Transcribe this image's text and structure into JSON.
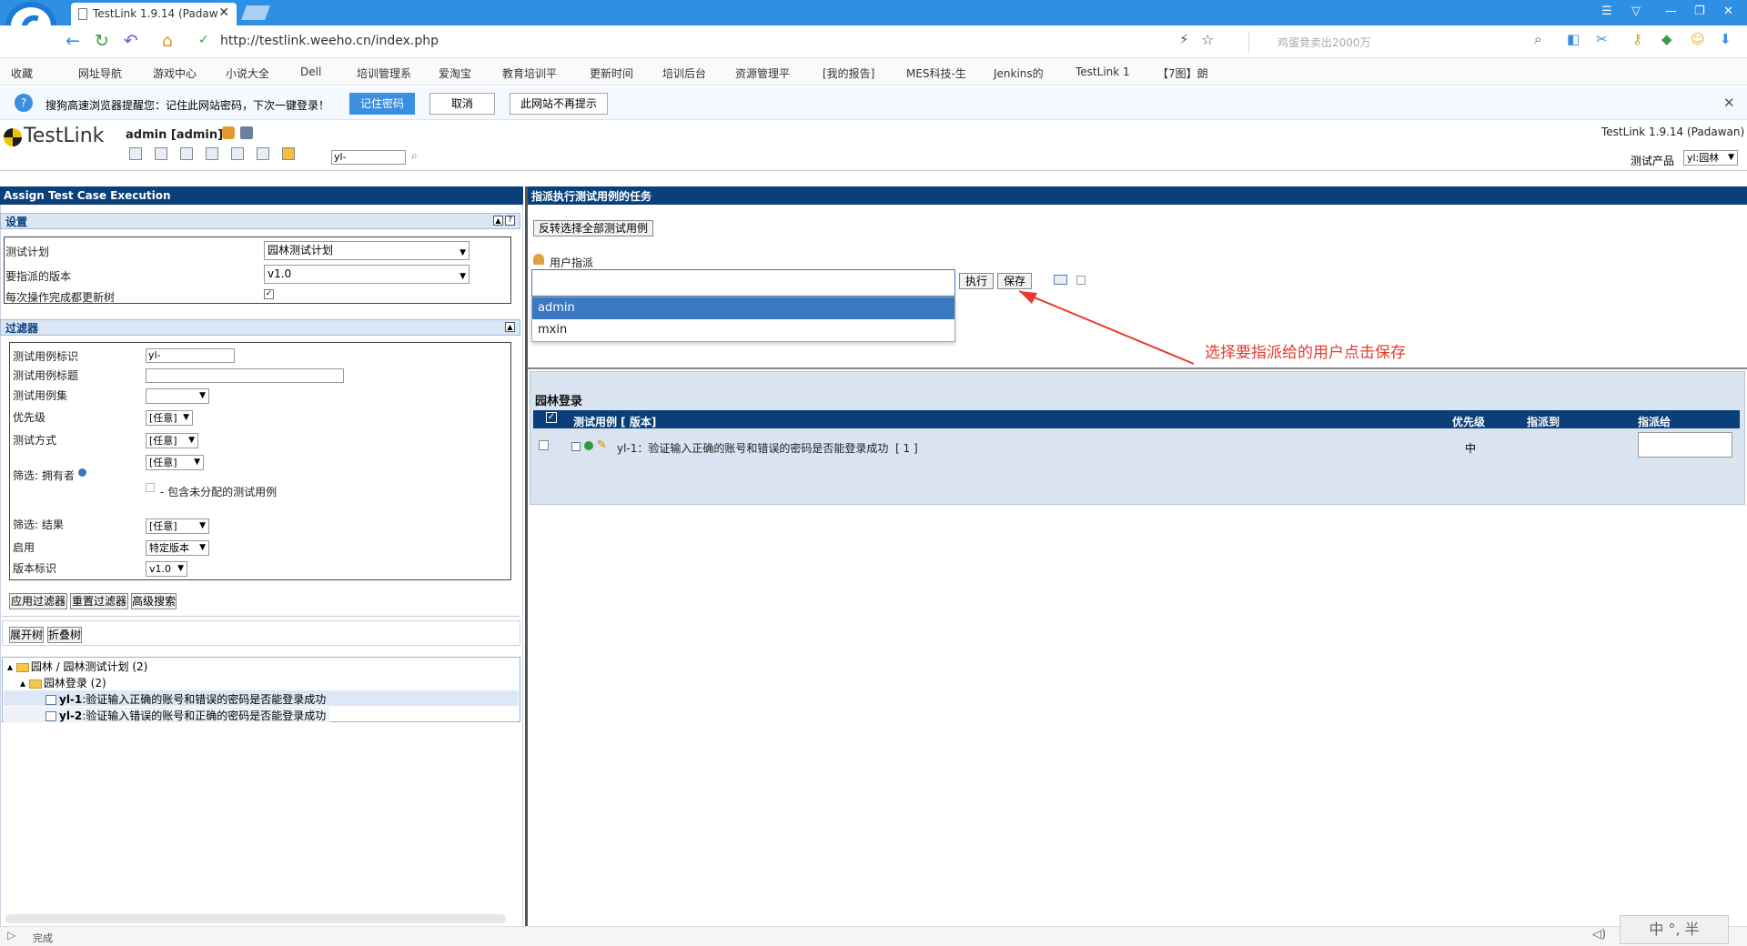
{
  "browser": {
    "tab_title": "TestLink 1.9.14 (Padaw",
    "url": "http://testlink.weeho.cn/index.php",
    "search_placeholder": "鸡蛋竞卖出2000万",
    "status_text": "完成",
    "ime_text": "中 °, 半",
    "bookmarks": [
      "收藏",
      "网址导航",
      "游戏中心",
      "小说大全",
      "Dell",
      "培训管理系",
      "爱淘宝",
      "教育培训平",
      "更新时间",
      "培训后台",
      "资源管理平",
      "[我的报告]",
      "MES科技-生",
      "Jenkins的",
      "TestLink 1",
      "【7图】朗"
    ],
    "password_bar": {
      "message": "搜狗高速浏览器提醒您：记住此网站密码，下次一键登录！",
      "remember": "记住密码",
      "cancel": "取消",
      "never": "此网站不再提示"
    }
  },
  "header": {
    "logo": "TestLink",
    "user": "admin [admin]",
    "version": "TestLink 1.9.14 (Padawan)",
    "search_value": "yl-",
    "product_label": "测试产品",
    "product_value": "yl:园林"
  },
  "left": {
    "title": "Assign Test Case Execution",
    "settings": {
      "title": "设置",
      "plan_label": "测试计划",
      "plan_value": "园林测试计划",
      "build_label": "要指派的版本",
      "build_value": "v1.0",
      "update_label": "每次操作完成都更新树"
    },
    "filters": {
      "title": "过滤器",
      "tc_id_label": "测试用例标识",
      "tc_id_value": "yl-",
      "tc_title_label": "测试用例标题",
      "suite_label": "测试用例集",
      "priority_label": "优先级",
      "priority_value": "[任意]",
      "exec_type_label": "测试方式",
      "exec_type_value": "[任意]",
      "owner_label": "筛选: 拥有者",
      "owner_value": "[任意]",
      "unassigned_label": "- 包含未分配的测试用例",
      "result_label": "筛选: 结果",
      "result_value": "[任意]",
      "enable_label": "启用",
      "enable_value": "特定版本",
      "build_label": "版本标识",
      "build_value": "v1.0",
      "apply": "应用过滤器",
      "reset": "重置过滤器",
      "advanced": "高级搜索"
    },
    "tree": {
      "expand": "展开树",
      "collapse": "折叠树",
      "root": "园林 / 园林测试计划 (2)",
      "suite": "园林登录 (2)",
      "cases": [
        {
          "id": "yl-1",
          "title": ":验证输入正确的账号和错误的密码是否能登录成功"
        },
        {
          "id": "yl-2",
          "title": ":验证输入错误的账号和正确的密码是否能登录成功"
        }
      ]
    }
  },
  "right": {
    "title": "指派执行测试用例的任务",
    "toggle_all": "反转选择全部测试用例",
    "user_assign_label": "用户指派",
    "execute_btn": "执行",
    "save_btn": "保存",
    "dropdown_options": [
      "admin",
      "mxin"
    ],
    "annotation": "选择要指派给的用户点击保存",
    "suite_title": "园林登录",
    "table": {
      "headers": [
        "测试用例 [ 版本]",
        "优先级",
        "指派到",
        "指派给"
      ],
      "rows": [
        {
          "case": "yl-1：验证输入正确的账号和错误的密码是否能登录成功",
          "version": "[ 1 ]",
          "priority": "中",
          "assigned_to": ""
        }
      ]
    }
  },
  "colors": {
    "accent": "#0a3f7a",
    "selected": "#3a78c2",
    "annotation": "#e43a2f"
  }
}
